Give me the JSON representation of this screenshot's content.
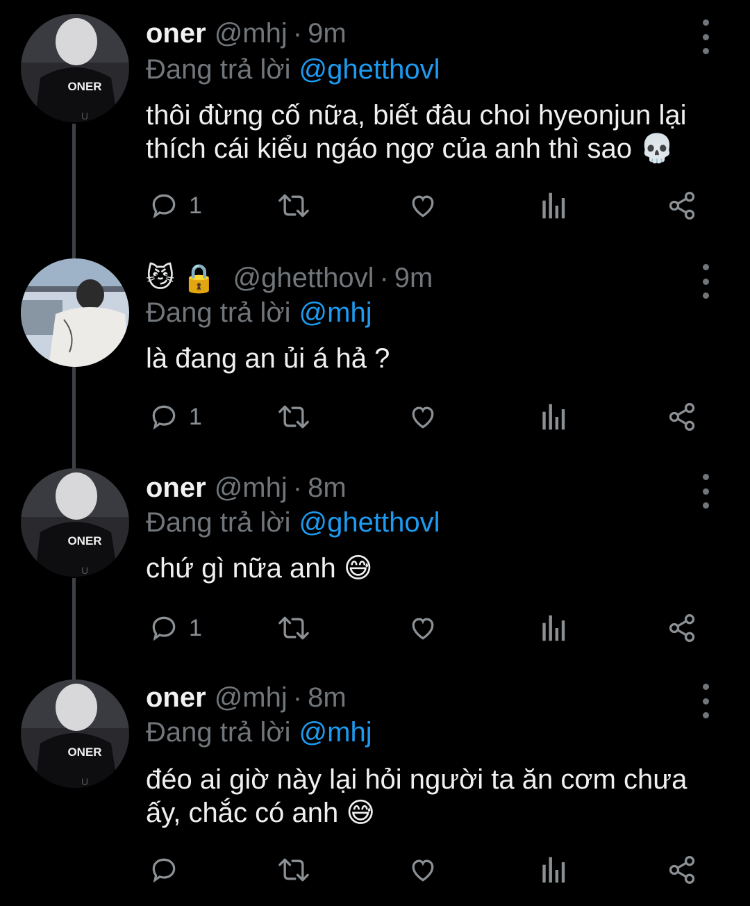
{
  "tweets": [
    {
      "name": "oner",
      "handle": "@mhj",
      "time": "9m",
      "replying_label": "Đang trả lời",
      "replying_to": "@ghetthovl",
      "text": "thôi đừng cố nữa, biết đâu choi hyeonjun lại thích cái kiểu ngáo ngơ của anh thì sao 💀",
      "reply_count": "1",
      "avatar_label": "ONER"
    },
    {
      "name_emojis": [
        "😼",
        "🔒"
      ],
      "handle": "@ghetthovl",
      "time": "9m",
      "replying_label": "Đang trả lời",
      "replying_to": "@mhj",
      "text": "là đang an ủi á hả ?",
      "reply_count": "1"
    },
    {
      "name": "oner",
      "handle": "@mhj",
      "time": "8m",
      "replying_label": "Đang trả lời",
      "replying_to": "@ghetthovl",
      "text": "chứ gì nữa anh 😅",
      "reply_count": "1",
      "avatar_label": "ONER"
    },
    {
      "name": "oner",
      "handle": "@mhj",
      "time": "8m",
      "replying_label": "Đang trả lời",
      "replying_to": "@mhj",
      "text": "đéo ai giờ này lại hỏi người ta ăn cơm chưa ấy, chắc có anh 😅",
      "reply_count": "",
      "avatar_label": "ONER"
    }
  ],
  "icons": [
    "reply-icon",
    "retweet-icon",
    "like-icon",
    "analytics-icon",
    "share-icon",
    "more-icon"
  ],
  "colors": {
    "background": "#000000",
    "muted": "#71767b",
    "mention": "#1d9bf0",
    "text": "#e7e9ea",
    "thread_line": "#3d4145"
  }
}
